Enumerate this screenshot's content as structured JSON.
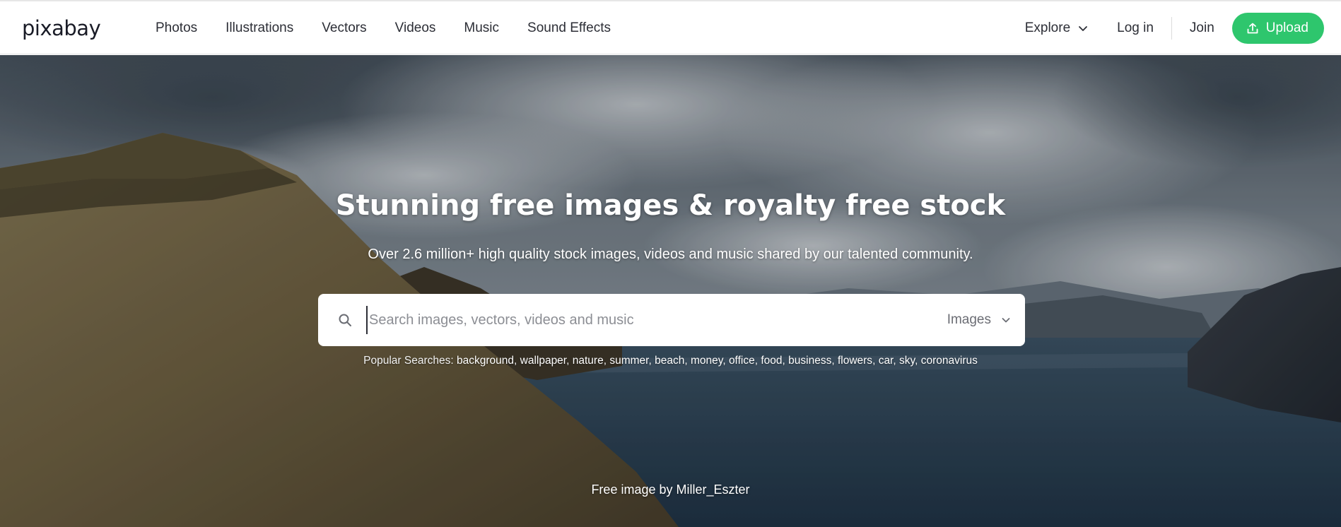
{
  "brand": {
    "logo": "pixabay",
    "accent_color": "#2ec66d"
  },
  "nav": {
    "items": [
      {
        "label": "Photos"
      },
      {
        "label": "Illustrations"
      },
      {
        "label": "Vectors"
      },
      {
        "label": "Videos"
      },
      {
        "label": "Music"
      },
      {
        "label": "Sound Effects"
      }
    ],
    "explore_label": "Explore",
    "login_label": "Log in",
    "join_label": "Join",
    "upload_label": "Upload"
  },
  "hero": {
    "title": "Stunning free images & royalty free stock",
    "subtitle": "Over 2.6 million+ high quality stock images, videos and music shared by our talented community.",
    "search": {
      "placeholder": "Search images, vectors, videos and music",
      "value": "",
      "type_selected": "Images"
    },
    "popular": {
      "label": "Popular Searches:",
      "terms": [
        "background",
        "wallpaper",
        "nature",
        "summer",
        "beach",
        "money",
        "office",
        "food",
        "business",
        "flowers",
        "car",
        "sky",
        "coronavirus"
      ]
    },
    "credit": {
      "prefix": "Free image by",
      "author": "Miller_Eszter"
    }
  },
  "icons": {
    "explore": "chevron-down-icon",
    "upload": "upload-icon",
    "search": "search-icon",
    "select": "chevron-down-icon"
  }
}
